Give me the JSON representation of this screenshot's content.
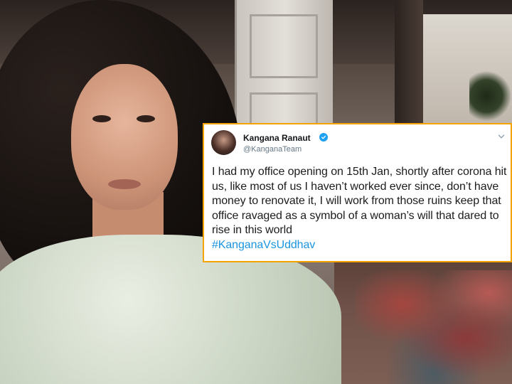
{
  "tweet": {
    "author_name": "Kangana Ranaut",
    "author_handle": "@KanganaTeam",
    "text": "I had my office opening on 15th Jan, shortly after corona hit us, like most of us I haven’t worked ever since, don’t have money to renovate it, I will work from those ruins keep that office ravaged as a symbol of a woman’s will that dared to rise in this world",
    "hashtag": "#KanganaVsUddhav",
    "accent_color": "#1b95e0",
    "border_color": "#f5a300",
    "icons": [
      "verified-badge-icon",
      "chevron-down-icon"
    ]
  }
}
